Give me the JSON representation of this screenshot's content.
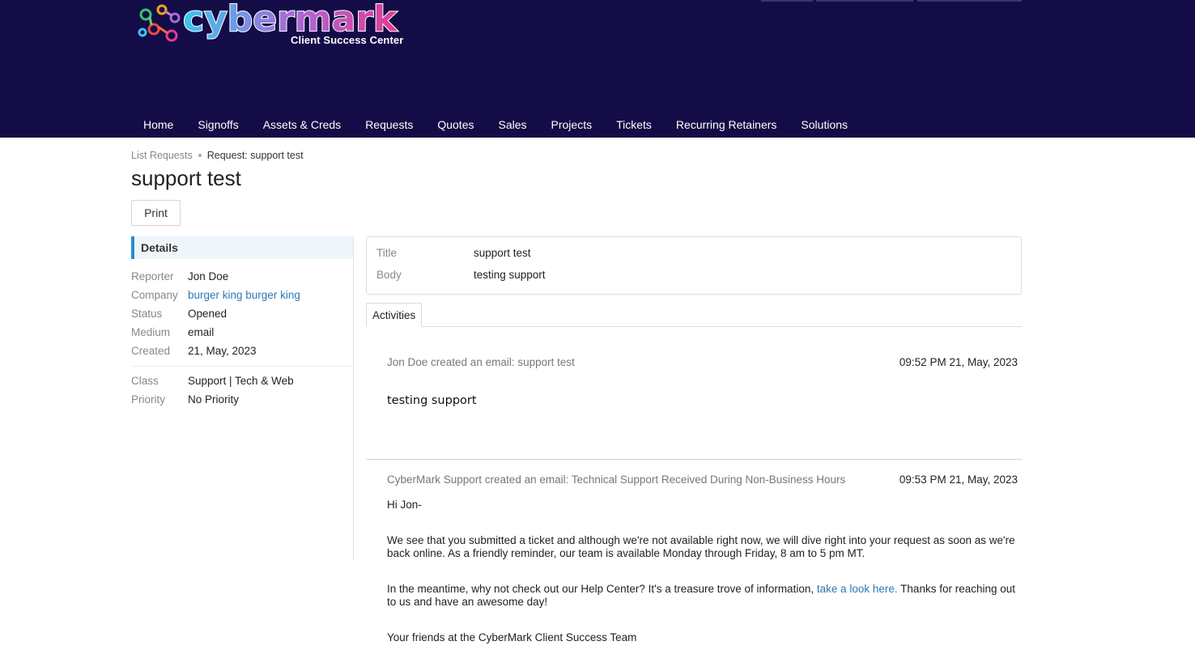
{
  "brand": {
    "logo_text": "cybermark",
    "subtitle": "Client Success Center"
  },
  "nav": [
    "Home",
    "Signoffs",
    "Assets & Creds",
    "Requests",
    "Quotes",
    "Sales",
    "Projects",
    "Tickets",
    "Recurring Retainers",
    "Solutions"
  ],
  "breadcrumb": {
    "parent": "List Requests",
    "current": "Request: support test"
  },
  "page_title": "support test",
  "print_label": "Print",
  "details": {
    "heading": "Details",
    "fields": [
      {
        "label": "Reporter",
        "value": "Jon Doe"
      },
      {
        "label": "Company",
        "value": "burger king burger king"
      },
      {
        "label": "Status",
        "value": "Opened"
      },
      {
        "label": "Medium",
        "value": "email"
      },
      {
        "label": "Created",
        "value": "21, May, 2023"
      }
    ],
    "extra": [
      {
        "label": "Class",
        "value": "Support | Tech & Web"
      },
      {
        "label": "Priority",
        "value": "No Priority"
      }
    ]
  },
  "request": {
    "title_label": "Title",
    "title_value": "support test",
    "body_label": "Body",
    "body_value": "testing support"
  },
  "tabs": {
    "activities": "Activities"
  },
  "activities": [
    {
      "header": "Jon Doe created an email: support test",
      "time": "09:52 PM 21, May, 2023",
      "body": "testing support"
    },
    {
      "header": "CyberMark Support created an email: Technical Support Received During Non-Business Hours",
      "time": "09:53 PM 21, May, 2023",
      "greeting": "Hi Jon-",
      "para1": "We see that you submitted a ticket and although we're not available right now, we will dive right into your request as soon as we're back online. As a friendly reminder, our team is available Monday through Friday, 8 am to 5 pm MT.",
      "para2_before": "In the meantime, why not check out our Help Center? It's a treasure trove of information, ",
      "para2_link": "take a look here.",
      "para2_after": " Thanks for reaching out to us and have an awesome day!",
      "signoff": "Your friends at the CyberMark Client Success Team"
    }
  ],
  "colors": {
    "header_bg": "#140c47",
    "link": "#2a7ab6",
    "accent": "#2a8bd0"
  }
}
